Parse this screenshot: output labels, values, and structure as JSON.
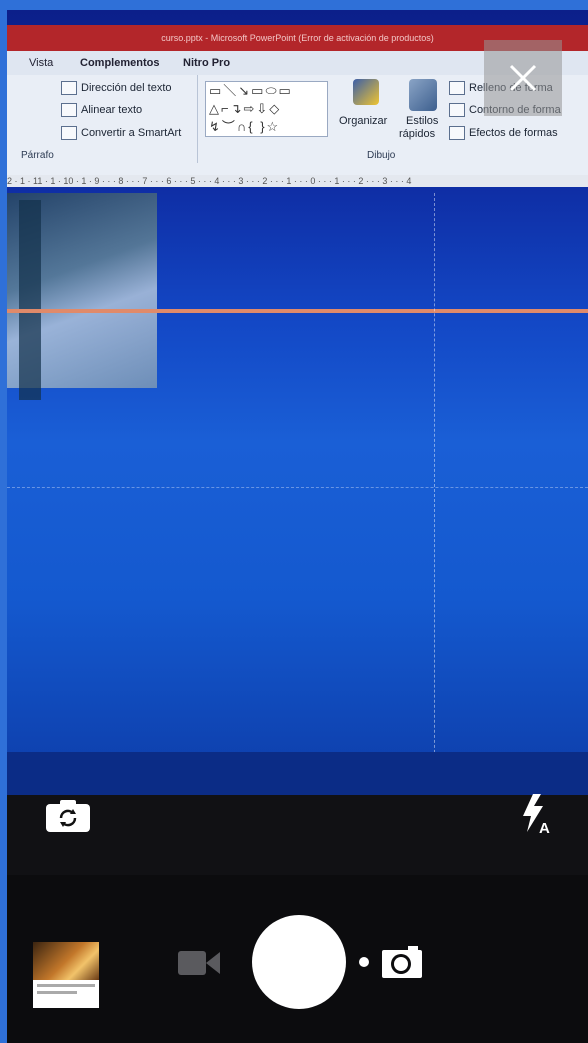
{
  "window_title": "",
  "ribbon": {
    "title_text": "curso.pptx - Microsoft PowerPoint (Error de activación de productos)",
    "tabs": [
      "Vista",
      "Complementos",
      "Nitro Pro"
    ],
    "paragraph_group": {
      "label": "Párrafo",
      "commands": [
        "Dirección del texto",
        "Alinear texto",
        "Convertir a SmartArt"
      ]
    },
    "drawing_group": {
      "label": "Dibujo",
      "commands": [
        "Organizar",
        "Estilos rápidos",
        "Relleno de forma",
        "Contorno de forma",
        "Efectos de formas"
      ],
      "estilos_line1": "Estilos",
      "estilos_line2": "rápidos"
    },
    "ruler_text": "2 · 1 · 11 · 1 · 10 · 1 · 9 · · · 8 · · · 7 · · · 6 · · · 5 · · · 4 · · · 3 · · · 2 · · · 1 · · · 0 · · · 1 · · · 2 · · · 3 · · · 4"
  },
  "camera": {
    "flash_mode_label": "A",
    "icons": {
      "close": "close-icon",
      "switch": "switch-camera-icon",
      "flash": "flash-auto-icon",
      "video": "video-camera-icon",
      "photo": "photo-camera-icon",
      "shutter": "shutter-button"
    }
  },
  "colors": {
    "screen_blue": "#1a5fd6",
    "ribbon_red": "#b3262a",
    "bar_dark": "#111114"
  }
}
